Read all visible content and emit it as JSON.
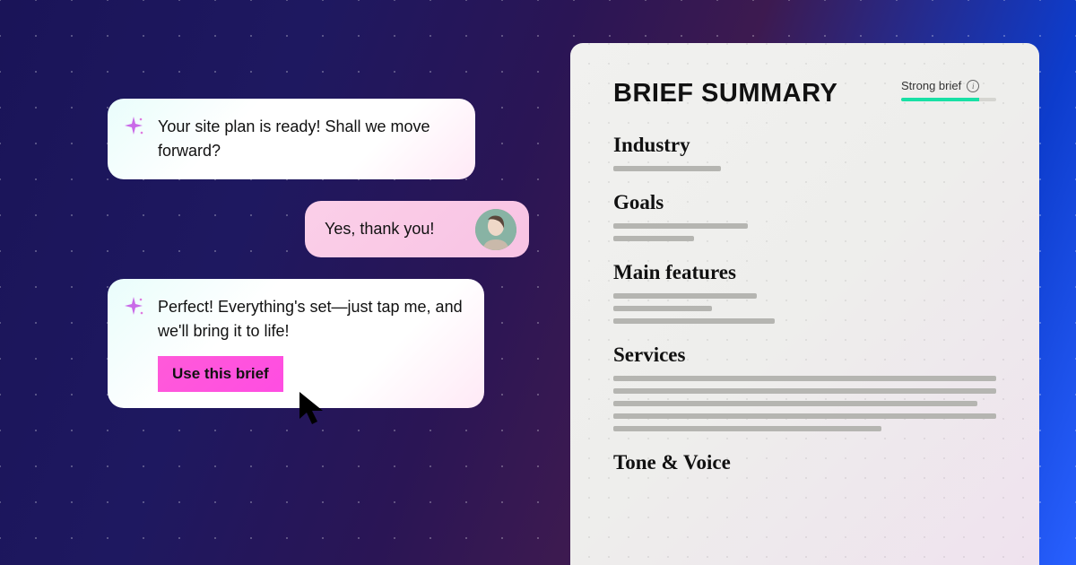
{
  "chat": {
    "messages": [
      {
        "role": "ai",
        "text": "Your site plan is ready! Shall we move forward?"
      },
      {
        "role": "user",
        "text": "Yes, thank you!"
      },
      {
        "role": "ai",
        "text": "Perfect! Everything's set—just tap me, and we'll bring it to life!",
        "cta": "Use this brief"
      }
    ]
  },
  "panel": {
    "title": "BRIEF SUMMARY",
    "strength_label": "Strong brief",
    "sections": {
      "industry": "Industry",
      "goals": "Goals",
      "main_features": "Main features",
      "services": "Services",
      "tone_voice": "Tone & Voice"
    }
  }
}
